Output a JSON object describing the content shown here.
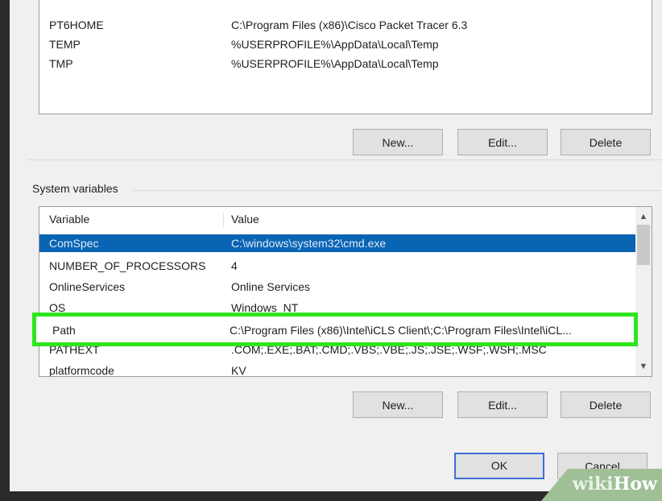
{
  "user_variables": {
    "rows": [
      {
        "variable": "PT6HOME",
        "value": "C:\\Program Files (x86)\\Cisco Packet Tracer 6.3"
      },
      {
        "variable": "TEMP",
        "value": "%USERPROFILE%\\AppData\\Local\\Temp"
      },
      {
        "variable": "TMP",
        "value": "%USERPROFILE%\\AppData\\Local\\Temp"
      }
    ],
    "buttons": {
      "new": "New...",
      "edit": "Edit...",
      "delete": "Delete"
    }
  },
  "system_variables": {
    "label": "System variables",
    "columns": {
      "variable": "Variable",
      "value": "Value"
    },
    "rows": [
      {
        "variable": "ComSpec",
        "value": "C:\\windows\\system32\\cmd.exe",
        "selected": true
      },
      {
        "variable": "NUMBER_OF_PROCESSORS",
        "value": "4"
      },
      {
        "variable": "OnlineServices",
        "value": "Online Services"
      },
      {
        "variable": "OS",
        "value": "Windows_NT"
      },
      {
        "variable": "Path",
        "value": "C:\\Program Files (x86)\\Intel\\iCLS Client\\;C:\\Program Files\\Intel\\iCL...",
        "highlighted": true
      },
      {
        "variable": "PATHEXT",
        "value": ".COM;.EXE;.BAT;.CMD;.VBS;.VBE;.JS;.JSE;.WSF;.WSH;.MSC"
      },
      {
        "variable": "platformcode",
        "value": "KV"
      }
    ],
    "buttons": {
      "new": "New...",
      "edit": "Edit...",
      "delete": "Delete"
    }
  },
  "dialog_buttons": {
    "ok": "OK",
    "cancel": "Cancel"
  },
  "watermark": {
    "part1": "wiki",
    "part2": "How"
  },
  "colors": {
    "selection": "#0a64b4",
    "highlight": "#2ee51d"
  }
}
